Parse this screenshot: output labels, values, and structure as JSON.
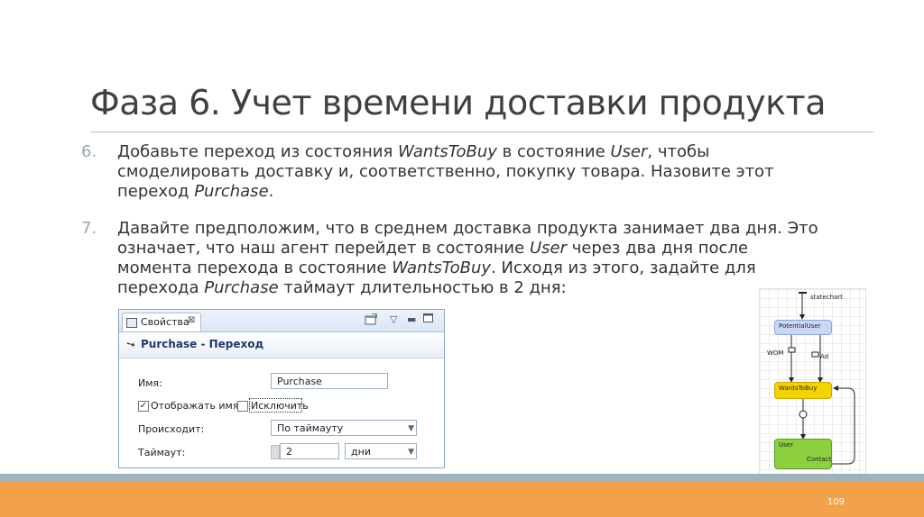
{
  "slide": {
    "title": "Фаза 6. Учет времени доставки продукта",
    "page_number": "109",
    "items": [
      {
        "number": "6.",
        "lines": [
          [
            {
              "t": "Добавьте переход из состояния "
            },
            {
              "t": "WantsToBuy",
              "i": true
            },
            {
              "t": " в состояние "
            },
            {
              "t": "User",
              "i": true
            },
            {
              "t": ", чтобы"
            }
          ],
          [
            {
              "t": "смоделировать доставку и, соответственно, покупку товара. Назовите этот"
            }
          ],
          [
            {
              "t": "переход "
            },
            {
              "t": "Purchase",
              "i": true
            },
            {
              "t": "."
            }
          ]
        ]
      },
      {
        "number": "7.",
        "lines": [
          [
            {
              "t": "Давайте предположим, что в среднем доставка продукта занимает два дня. Это"
            }
          ],
          [
            {
              "t": "означает, что наш агент перейдет в состояние "
            },
            {
              "t": "User",
              "i": true
            },
            {
              "t": " через два дня после"
            }
          ],
          [
            {
              "t": "момента перехода в состояние "
            },
            {
              "t": "WantsToBuy",
              "i": true
            },
            {
              "t": ". Исходя из этого, задайте для"
            }
          ],
          [
            {
              "t": "перехода "
            },
            {
              "t": "Purchase",
              "i": true
            },
            {
              "t": " таймаут длительностью в 2 дня:"
            }
          ]
        ]
      }
    ]
  },
  "properties_panel": {
    "tab_label": "Свойства",
    "tab_close": "⊠",
    "header_title": "Purchase - Переход",
    "name_label": "Имя:",
    "name_value": "Purchase",
    "show_name_label": "Отображать имя",
    "show_name_checked": true,
    "exclude_label": "Исключить",
    "exclude_checked": false,
    "occurs_label": "Происходит:",
    "occurs_value": "По таймауту",
    "timeout_label": "Таймаут:",
    "timeout_value": "2",
    "timeout_unit": "дни",
    "icons": [
      "properties-icon",
      "new-window-icon",
      "view-menu-icon",
      "minimize-icon",
      "maximize-icon"
    ]
  },
  "statechart": {
    "entry_label": "statechart",
    "states": [
      "PotentialUser",
      "WantsToBuy",
      "User"
    ],
    "transitions": [
      "WOM",
      "Ad",
      "Contact"
    ],
    "colors": {
      "potential_user": "#c9d8f5",
      "wants_to_buy": "#f5d300",
      "user": "#8ccf3f"
    }
  },
  "colors": {
    "band_gray": "#9fb2bd",
    "band_orange": "#f2a24a",
    "number_color": "#8ea9b5"
  }
}
